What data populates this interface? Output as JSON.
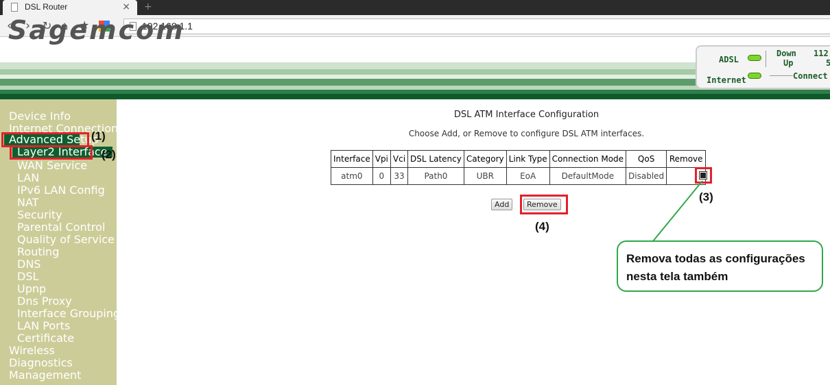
{
  "browser": {
    "tab_title": "DSL Router",
    "tab_close": "×",
    "new_tab": "+",
    "url": "192.168.1.1"
  },
  "header": {
    "logo_text": "Sagemcom",
    "status": {
      "adsl_label": "ADSL",
      "internet_label": "Internet",
      "down_label": "Down",
      "up_label": "Up",
      "down_value": "112",
      "up_value": "5",
      "connect_label": "Connect",
      "led_color": "#7bd82a"
    }
  },
  "sidebar": {
    "items": [
      {
        "label": "Device Info",
        "level": 0
      },
      {
        "label": "Internet Connection",
        "level": 0
      },
      {
        "label": "Advanced Setup",
        "level": 0,
        "selected": true
      },
      {
        "label": "Layer2 Interface",
        "level": 1,
        "selected": true
      },
      {
        "label": "WAN Service",
        "level": 1
      },
      {
        "label": "LAN",
        "level": 1
      },
      {
        "label": "IPv6 LAN Config",
        "level": 1
      },
      {
        "label": "NAT",
        "level": 1
      },
      {
        "label": "Security",
        "level": 1
      },
      {
        "label": "Parental Control",
        "level": 1
      },
      {
        "label": "Quality of Service",
        "level": 1
      },
      {
        "label": "Routing",
        "level": 1
      },
      {
        "label": "DNS",
        "level": 1
      },
      {
        "label": "DSL",
        "level": 1
      },
      {
        "label": "Upnp",
        "level": 1
      },
      {
        "label": "Dns Proxy",
        "level": 1
      },
      {
        "label": "Interface Grouping",
        "level": 1
      },
      {
        "label": "LAN Ports",
        "level": 1
      },
      {
        "label": "Certificate",
        "level": 1
      },
      {
        "label": "Wireless",
        "level": 0
      },
      {
        "label": "Diagnostics",
        "level": 0
      },
      {
        "label": "Management",
        "level": 0
      }
    ]
  },
  "main": {
    "title": "DSL ATM Interface Configuration",
    "description": "Choose Add, or Remove to configure DSL ATM interfaces.",
    "table": {
      "headers": [
        "Interface",
        "Vpi",
        "Vci",
        "DSL Latency",
        "Category",
        "Link Type",
        "Connection Mode",
        "QoS",
        "Remove"
      ],
      "rows": [
        [
          "atm0",
          "0",
          "33",
          "Path0",
          "UBR",
          "EoA",
          "DefaultMode",
          "Disabled",
          ""
        ]
      ]
    },
    "add_button": "Add",
    "remove_button": "Remove"
  },
  "annotations": {
    "step1": "(1)",
    "step2": "(2)",
    "step3": "(3)",
    "step4": "(4)",
    "callout": "Remova todas as configurações nesta tela também",
    "highlight_color": "#e3212b",
    "callout_color": "#2fa84a"
  }
}
